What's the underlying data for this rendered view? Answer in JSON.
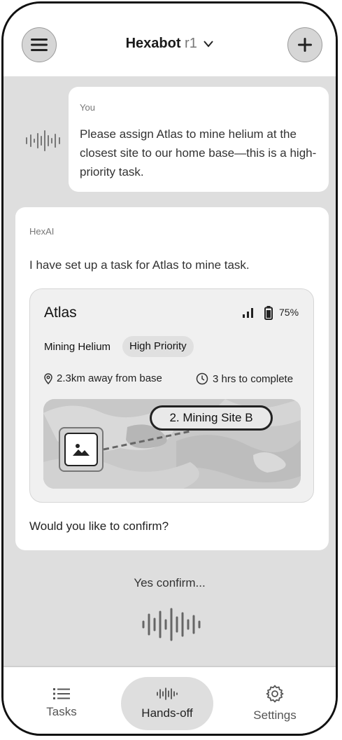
{
  "header": {
    "app_name": "Hexabot",
    "version": "r1",
    "menu_icon": "hamburger-menu-icon",
    "add_icon": "plus-icon",
    "dropdown_icon": "chevron-down-icon"
  },
  "chat": {
    "user_message": {
      "sender": "You",
      "text": "Please assign Atlas to mine helium at the closest site to our home base—this is a high-priority task."
    },
    "ai_message": {
      "sender": "HexAI",
      "text": "I have set up a task for Atlas to mine task.",
      "followup": "Would you like to confirm?"
    },
    "task_card": {
      "robot_name": "Atlas",
      "battery": "75%",
      "task": "Mining Helium",
      "priority": "High Priority",
      "distance": "2.3km away from base",
      "duration": "3 hrs to complete",
      "destination": "2. Mining Site B"
    },
    "transcript": "Yes confirm..."
  },
  "tabs": [
    {
      "label": "Tasks",
      "icon": "list-icon"
    },
    {
      "label": "Hands-off",
      "icon": "voice-wave-icon"
    },
    {
      "label": "Settings",
      "icon": "gear-icon"
    }
  ],
  "colors": {
    "background": "#dedede",
    "surface": "#ffffff",
    "card": "#f0f0f0",
    "accent": "#111111"
  }
}
